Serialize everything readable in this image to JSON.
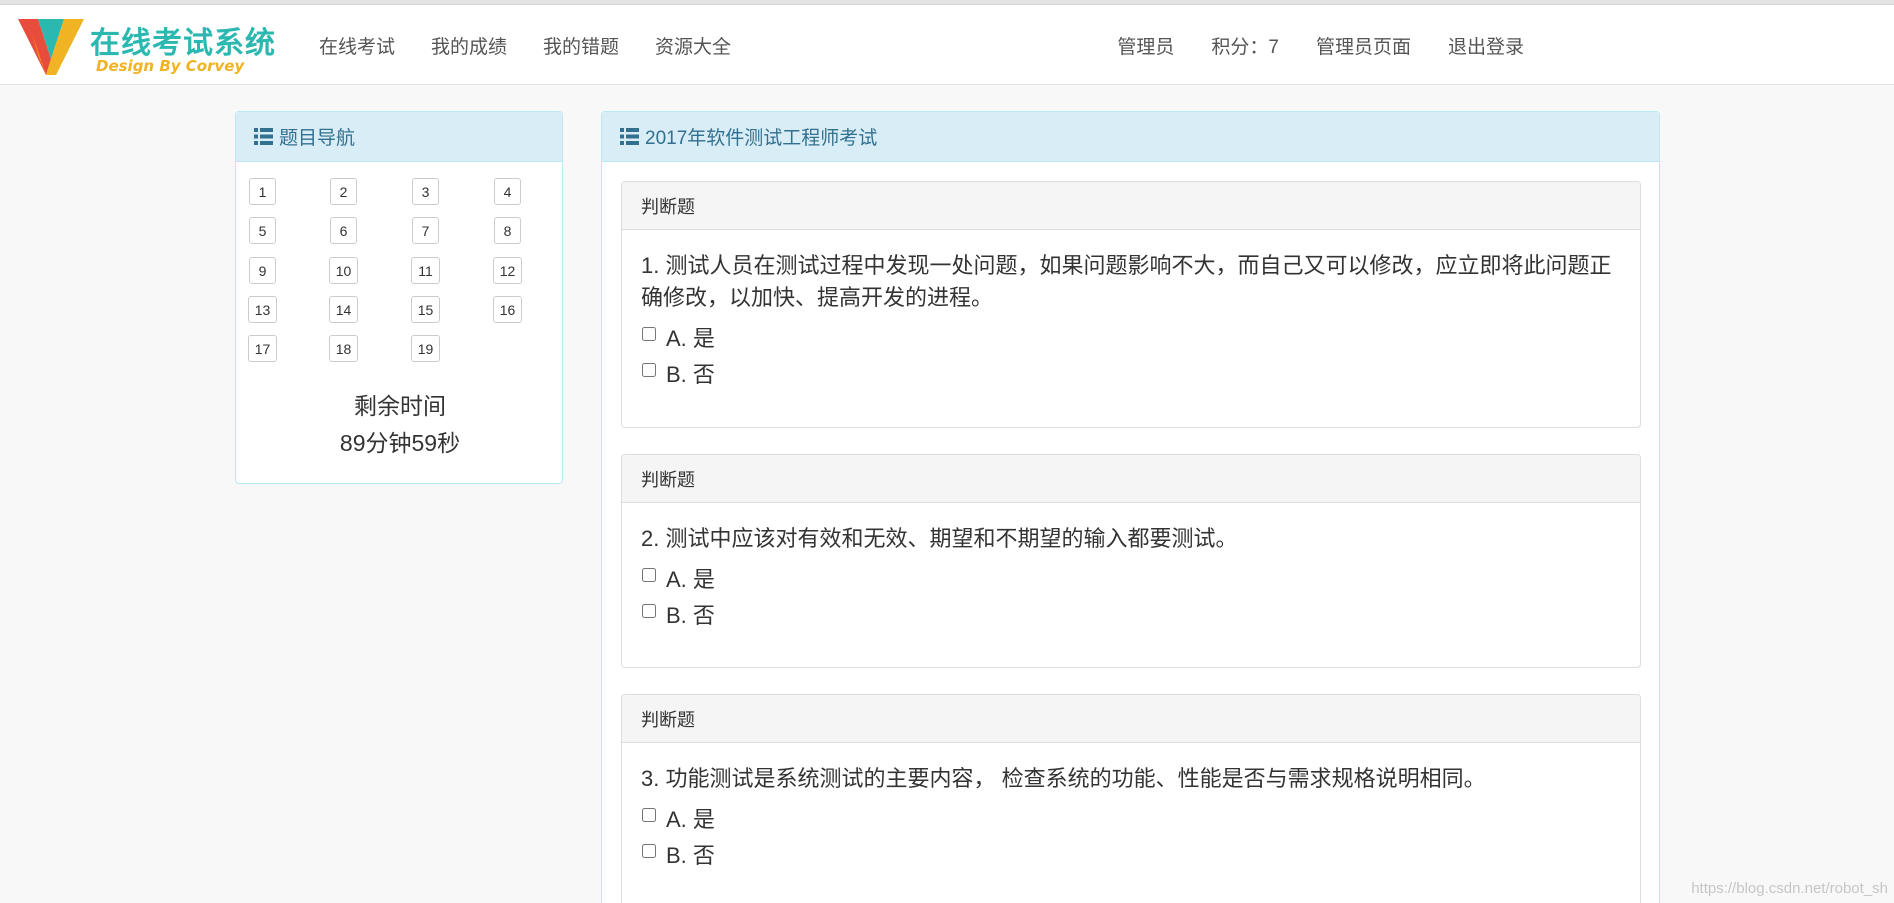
{
  "brand": {
    "title": "在线考试系统",
    "subtitle": "Design By Corvey",
    "colors": {
      "teal": "#2bb8b0",
      "orange": "#f0b323",
      "red": "#e84c3d"
    }
  },
  "nav": {
    "left": [
      "在线考试",
      "我的成绩",
      "我的错题",
      "资源大全"
    ],
    "user": "管理员",
    "points": "积分：7",
    "admin_page": "管理员页面",
    "logout": "退出登录"
  },
  "sidebar": {
    "heading": "题目导航",
    "question_numbers": [
      "1",
      "2",
      "3",
      "4",
      "5",
      "6",
      "7",
      "8",
      "9",
      "10",
      "11",
      "12",
      "13",
      "14",
      "15",
      "16",
      "17",
      "18",
      "19"
    ],
    "timer_label": "剩余时间",
    "timer_value": "89分钟59秒"
  },
  "exam": {
    "heading": "2017年软件测试工程师考试",
    "questions": [
      {
        "type": "判断题",
        "text": "1. 测试人员在测试过程中发现一处问题，如果问题影响不大，而自己又可以修改，应立即将此问题正确修改，以加快、提高开发的进程。",
        "options": [
          "A. 是",
          "B. 否"
        ]
      },
      {
        "type": "判断题",
        "text": "2. 测试中应该对有效和无效、期望和不期望的输入都要测试。",
        "options": [
          "A. 是",
          "B. 否"
        ]
      },
      {
        "type": "判断题",
        "text": "3. 功能测试是系统测试的主要内容， 检查系统的功能、性能是否与需求规格说明相同。",
        "options": [
          "A. 是",
          "B. 否"
        ]
      }
    ]
  },
  "watermark": "https://blog.csdn.net/robot_sh",
  "icons": {
    "logo": "v-logo-icon",
    "list": "list-icon"
  },
  "theme": {
    "panel_heading_bg": "#d9edf7",
    "panel_heading_text": "#31708f",
    "panel_border": "#bce8f1",
    "page_bg": "#f8f8f8"
  }
}
